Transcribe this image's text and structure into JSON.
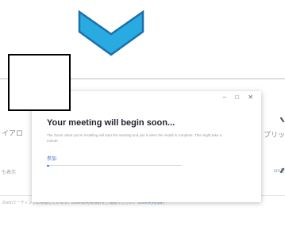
{
  "pointer_arrow": {
    "icon": "chevron-down-icon",
    "fill_color": "#29ABE2",
    "stroke_color": "#1C6FA8"
  },
  "background": {
    "left_fragment_1": "イアロ",
    "left_fragment_2": "も表示",
    "right_fragment_1": "プリッ",
    "right_fragment_2": "omを",
    "bottom_text": "Zoomミーティングに参加しています。Zoomの利用規約をご確認ください。",
    "bottom_link": "Zoom利用規約"
  },
  "dialog": {
    "controls": {
      "minimize": "–",
      "maximize": "□",
      "close": "✕"
    },
    "title": "Your meeting will begin soon...",
    "description": "The Zoom client you're installing will start the meeting and join it when the install is complete. This might take a minute.",
    "link_text": "参加",
    "progress": 0.02,
    "accent_color": "#2D8CFF"
  }
}
